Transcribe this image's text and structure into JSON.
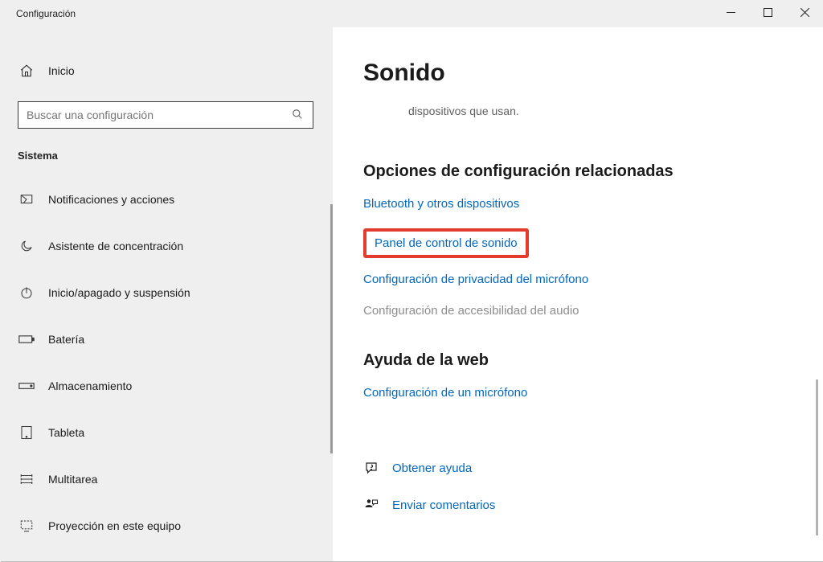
{
  "window": {
    "title": "Configuración"
  },
  "sidebar": {
    "home": "Inicio",
    "search_placeholder": "Buscar una configuración",
    "section": "Sistema",
    "items": [
      {
        "label": "Notificaciones y acciones"
      },
      {
        "label": "Asistente de concentración"
      },
      {
        "label": "Inicio/apagado y suspensión"
      },
      {
        "label": "Batería"
      },
      {
        "label": "Almacenamiento"
      },
      {
        "label": "Tableta"
      },
      {
        "label": "Multitarea"
      },
      {
        "label": "Proyección en este equipo"
      }
    ]
  },
  "main": {
    "heading": "Sonido",
    "subtitle": "dispositivos que usan.",
    "related_heading": "Opciones de configuración relacionadas",
    "links": {
      "bluetooth": "Bluetooth y otros dispositivos",
      "sound_panel": "Panel de control de sonido",
      "mic_privacy": "Configuración de privacidad del micrófono",
      "audio_access": "Configuración de accesibilidad del audio"
    },
    "webhelp_heading": "Ayuda de la web",
    "webhelp_link": "Configuración de un micrófono",
    "get_help": "Obtener ayuda",
    "feedback": "Enviar comentarios"
  }
}
